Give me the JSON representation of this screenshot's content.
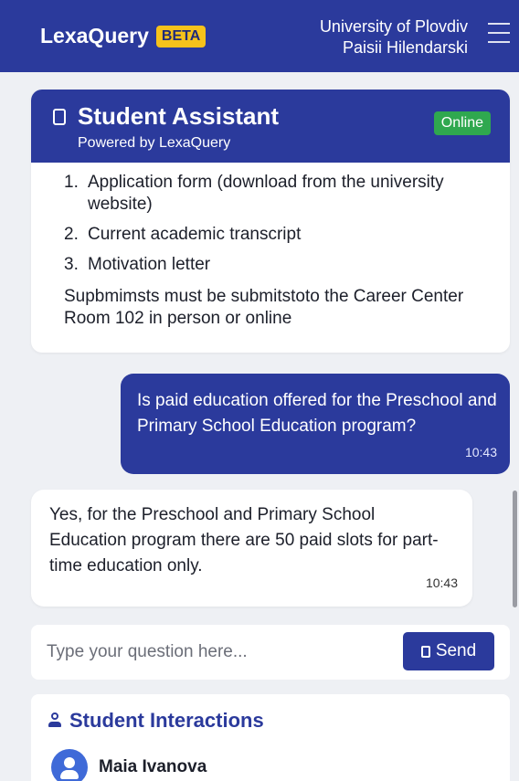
{
  "header": {
    "brand": "LexaQuery",
    "badge": "BETA",
    "university_line1": "University of Plovdiv",
    "university_line2": "Paisii Hilendarski",
    "menu_icon": "hamburger-menu-icon"
  },
  "chat": {
    "title": "Student Assistant",
    "subtitle": "Powered by LexaQuery",
    "status": "Online",
    "assistant_message_1": {
      "items": [
        {
          "num": "1.",
          "text": "Application form (download from the university website)"
        },
        {
          "num": "2.",
          "text": "Current academic transcript"
        },
        {
          "num": "3.",
          "text": "Motivation letter"
        }
      ],
      "note": "Supbmimsts must be submitstoto the Career Center Room 102 in person or online"
    },
    "user_message": {
      "text": "Is paid education offered for the Preschool and Primary School Education program?",
      "time": "10:43"
    },
    "assistant_message_2": {
      "text": "Yes, for the Preschool and Primary School Education program there are 50 paid slots for part-time education only.",
      "time": "10:43"
    }
  },
  "composer": {
    "placeholder": "Type your question here...",
    "send_label": "Send"
  },
  "interactions": {
    "title": "Student Interactions",
    "students": [
      {
        "name": "Maia Ivanova"
      }
    ]
  },
  "colors": {
    "primary": "#2b3a9c",
    "badge": "#f6c21b",
    "online": "#2fa84f",
    "background": "#eef0f4"
  }
}
